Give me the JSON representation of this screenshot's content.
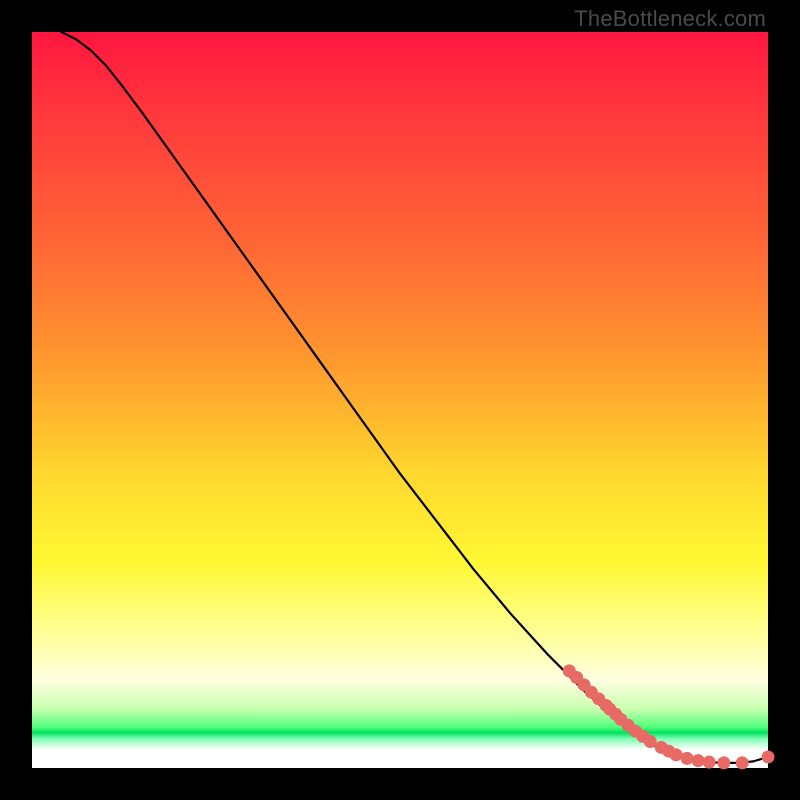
{
  "watermark": "TheBottleneck.com",
  "colors": {
    "curve": "#000000",
    "dot_fill": "#e76a65",
    "dot_stroke": "#e76a65"
  },
  "chart_data": {
    "type": "line",
    "title": "",
    "xlabel": "",
    "ylabel": "",
    "xlim": [
      0,
      100
    ],
    "ylim": [
      0,
      100
    ],
    "grid": false,
    "legend": false,
    "series": [
      {
        "name": "bottleneck-curve",
        "kind": "line",
        "x": [
          4,
          6,
          8,
          10,
          12,
          15,
          20,
          25,
          30,
          35,
          40,
          45,
          50,
          55,
          60,
          65,
          70,
          75,
          80,
          82,
          84,
          86,
          88,
          90,
          92,
          94,
          96,
          98,
          100
        ],
        "y": [
          100,
          99,
          97.5,
          95.5,
          93,
          89,
          82,
          75,
          68,
          61,
          54,
          47,
          40,
          33.5,
          27,
          21,
          15.5,
          10.5,
          6,
          4.5,
          3.3,
          2.3,
          1.5,
          1.0,
          0.8,
          0.7,
          0.7,
          0.9,
          1.5
        ]
      },
      {
        "name": "dense-segment-dots",
        "kind": "scatter",
        "x": [
          73,
          74,
          75,
          76,
          77,
          78,
          78.5,
          79.3,
          80,
          81,
          82,
          83,
          84,
          85.5,
          86.5,
          87.5,
          89,
          90.5,
          92,
          94,
          96.5,
          100
        ],
        "y": [
          13.2,
          12.3,
          11.3,
          10.3,
          9.4,
          8.5,
          8.0,
          7.3,
          6.6,
          5.8,
          5.0,
          4.3,
          3.6,
          2.8,
          2.3,
          1.8,
          1.3,
          1.0,
          0.8,
          0.7,
          0.7,
          1.5
        ]
      }
    ]
  }
}
